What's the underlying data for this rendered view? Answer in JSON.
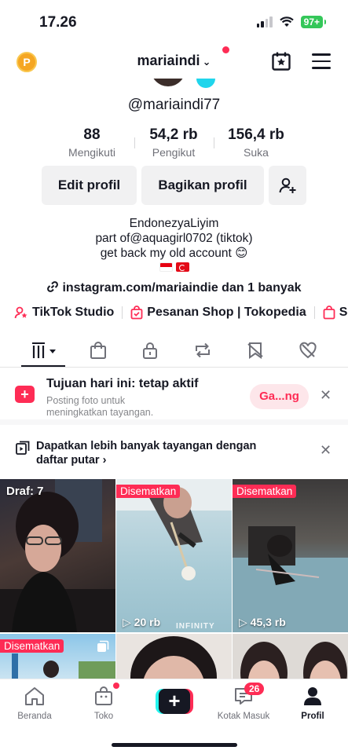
{
  "status": {
    "time": "17.26",
    "battery": "97+"
  },
  "header": {
    "username": "mariaindi",
    "coin_label": "P"
  },
  "profile": {
    "handle": "@mariaindi77",
    "stats": [
      {
        "value": "88",
        "label": "Mengikuti"
      },
      {
        "value": "54,2 rb",
        "label": "Pengikut"
      },
      {
        "value": "156,4 rb",
        "label": "Suka"
      }
    ],
    "buttons": {
      "edit": "Edit profil",
      "share": "Bagikan profil"
    },
    "bio": [
      "EndonezyaLiyim",
      "part of@aquagirl0702 (tiktok)",
      "get back my old account 😊"
    ],
    "link": "instagram.com/mariaindie dan 1 banyak"
  },
  "shortcuts": [
    "TikTok Studio",
    "Pesanan Shop | Tokopedia",
    "Sh"
  ],
  "goal": {
    "title": "Tujuan hari ini: tetap aktif",
    "desc": "Posting foto untuk meningkatkan tayangan.",
    "button": "Ga...ng"
  },
  "playlist": {
    "text": "Dapatkan lebih banyak tayangan dengan daftar putar"
  },
  "grid": {
    "draft_label": "Draf: 7",
    "pinned_label": "Disematkan",
    "views": [
      "20 rb",
      "45,3 rb"
    ],
    "watermark": "INFINITY"
  },
  "nav": {
    "home": "Beranda",
    "shop": "Toko",
    "inbox": "Kotak Masuk",
    "inbox_badge": "26",
    "profile": "Profil"
  },
  "colors": {
    "accent": "#fe2c55",
    "cyan": "#25f4ee",
    "text": "#161823"
  }
}
